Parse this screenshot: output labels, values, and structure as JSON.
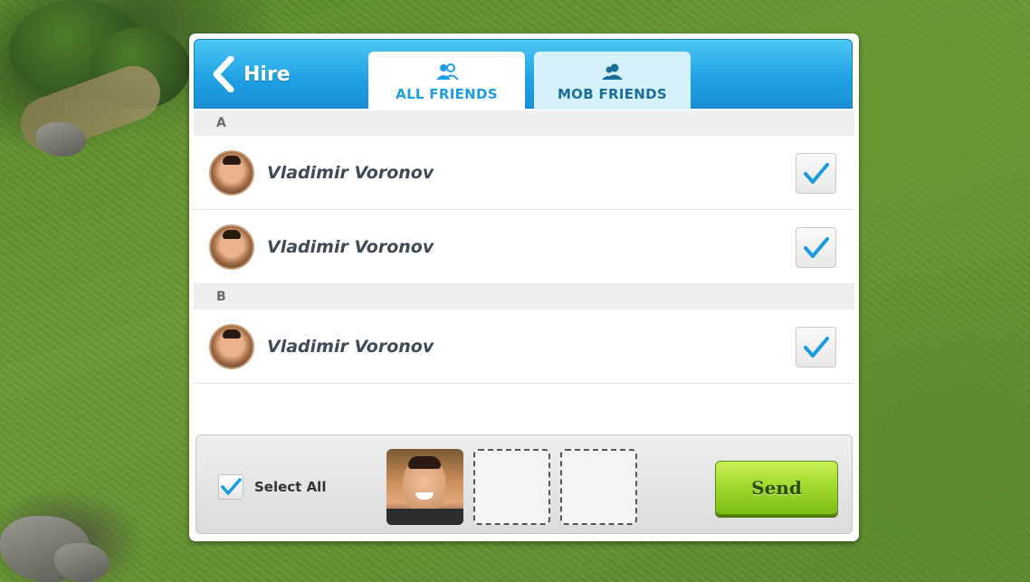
{
  "header": {
    "back_label": "Hire",
    "tabs": [
      {
        "label": "ALL FRIENDS",
        "active": true,
        "icon": "friends-group-icon"
      },
      {
        "label": "MOB FRIENDS",
        "active": false,
        "icon": "mob-group-icon"
      }
    ]
  },
  "sections": [
    {
      "letter": "A",
      "friends": [
        {
          "name": "Vladimir Voronov",
          "checked": true
        },
        {
          "name": "Vladimir Voronov",
          "checked": true
        }
      ]
    },
    {
      "letter": "B",
      "friends": [
        {
          "name": "Vladimir Voronov",
          "checked": true
        }
      ]
    }
  ],
  "footer": {
    "select_all_label": "Select All",
    "select_all_checked": true,
    "send_label": "Send",
    "slots": [
      "filled",
      "empty",
      "empty"
    ]
  },
  "colors": {
    "header_blue": "#1fa0e3",
    "check_blue": "#1a9be0",
    "send_green": "#9fd72b"
  }
}
